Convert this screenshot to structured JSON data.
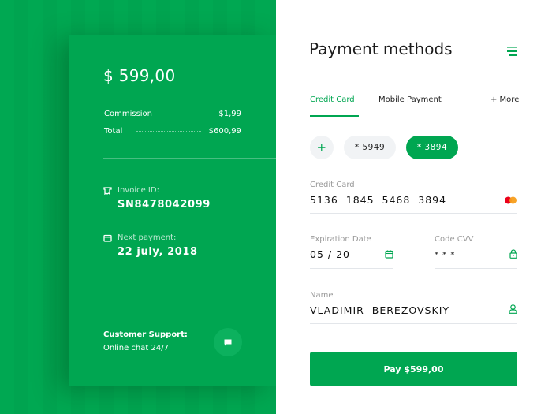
{
  "colors": {
    "accent": "#00a651",
    "background": "#00a852",
    "panel": "#ffffff"
  },
  "summary": {
    "amount": "$ 599,00",
    "rows": [
      {
        "label": "Commission",
        "value": "$1,99"
      },
      {
        "label": "Total",
        "value": "$600,99"
      }
    ],
    "invoice": {
      "label": "Invoice ID:",
      "value": "SN8478042099",
      "icon": "receipt-icon"
    },
    "next_payment": {
      "label": "Next payment:",
      "value": "22 july, 2018",
      "icon": "calendar-icon"
    },
    "support": {
      "title": "Customer Support:",
      "subtitle": "Online chat 24/7",
      "icon": "chat-icon"
    }
  },
  "panel": {
    "title": "Payment methods",
    "menu_icon": "menu-icon",
    "tabs": [
      {
        "label": "Credit Card",
        "active": true
      },
      {
        "label": "Mobile Payment",
        "active": false
      },
      {
        "label": "+ More",
        "active": false
      }
    ],
    "cards": [
      {
        "label": "+",
        "type": "add"
      },
      {
        "label": "* 5949",
        "selected": false
      },
      {
        "label": "* 3894",
        "selected": true
      }
    ],
    "fields": {
      "card": {
        "label": "Credit Card",
        "value": "5136  1845  5468  3894",
        "icon": "mastercard-icon"
      },
      "expiration": {
        "label": "Expiration Date",
        "value": "05 / 20",
        "icon": "calendar-icon"
      },
      "cvv": {
        "label": "Code CVV",
        "value": "* * *",
        "icon": "lock-icon"
      },
      "name": {
        "label": "Name",
        "value": "VLADIMIR  BEREZOVSKIY",
        "icon": "user-icon"
      }
    },
    "pay_button": "Pay $599,00"
  }
}
